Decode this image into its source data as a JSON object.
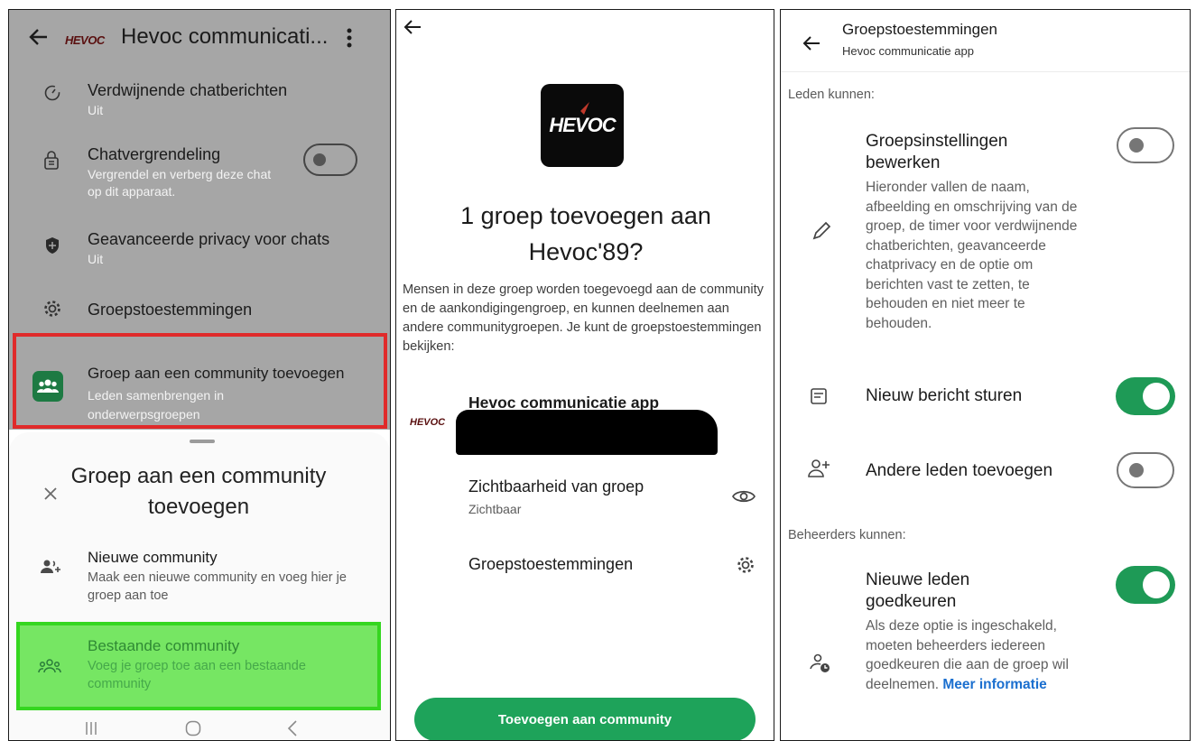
{
  "colors": {
    "whatsapp_green": "#1ea35a",
    "highlight_red": "#e02a2a",
    "highlight_green": "#76e663"
  },
  "panel1": {
    "title": "Hevoc communicati...",
    "logo_text": "HEVOC",
    "rows": [
      {
        "title": "Verdwijnende chatberichten",
        "subtitle": "Uit",
        "icon": "timer-icon"
      },
      {
        "title": "Chatvergrendeling",
        "subtitle": "Vergrendel en verberg deze chat op dit apparaat.",
        "icon": "chat-lock-icon"
      },
      {
        "title": "Geavanceerde privacy voor chats",
        "subtitle": "Uit",
        "icon": "shield-icon"
      },
      {
        "title": "Groepstoestemmingen",
        "subtitle": "",
        "icon": "gear-icon"
      },
      {
        "title": "Groep aan een community toevoegen",
        "subtitle": "Leden samenbrengen in onderwerpsgroepen",
        "icon": "community-icon"
      }
    ],
    "sheet": {
      "title": "Groep aan een community toevoegen",
      "options": [
        {
          "title": "Nieuwe community",
          "subtitle": "Maak een nieuwe community en voeg hier je groep aan toe",
          "icon": "add-group-icon"
        },
        {
          "title": "Bestaande community",
          "subtitle": "Voeg je groep toe aan een bestaande community",
          "icon": "existing-community-icon"
        }
      ]
    }
  },
  "panel2": {
    "logo_text": "HEVOC",
    "heading": "1 groep toevoegen aan Hevoc'89?",
    "description": "Mensen in deze groep worden toegevoegd aan de community en de aankondigingengroep, en kunnen deelnemen aan andere communitygroepen. Je kunt de groepstoestemmingen bekijken:",
    "group_name": "Hevoc communicatie app",
    "rows": [
      {
        "title": "Zichtbaarheid van groep",
        "subtitle": "Zichtbaar",
        "icon": "eye-icon"
      },
      {
        "title": "Groepstoestemmingen",
        "subtitle": "",
        "icon": "gear-icon"
      }
    ],
    "cta": "Toevoegen aan community"
  },
  "panel3": {
    "title": "Groepstoestemmingen",
    "subtitle": "Hevoc communicatie app",
    "section_members": "Leden kunnen:",
    "section_admins": "Beheerders kunnen:",
    "items": [
      {
        "title": "Groepsinstellingen bewerken",
        "description": "Hieronder vallen de naam, afbeelding en omschrijving van de groep, de timer voor verdwijnende chatberichten, geavanceerde chatprivacy en de optie om berichten vast te zetten, te behouden en niet meer te behouden.",
        "icon": "pencil-icon",
        "enabled": false
      },
      {
        "title": "Nieuw bericht sturen",
        "description": "",
        "icon": "message-icon",
        "enabled": true
      },
      {
        "title": "Andere leden toevoegen",
        "description": "",
        "icon": "add-person-icon",
        "enabled": false
      },
      {
        "title": "Nieuwe leden goedkeuren",
        "description": "Als deze optie is ingeschakeld, moeten beheerders iedereen goedkeuren die aan de groep wil deelnemen.",
        "link": "Meer informatie",
        "icon": "approve-person-icon",
        "enabled": true
      }
    ]
  }
}
